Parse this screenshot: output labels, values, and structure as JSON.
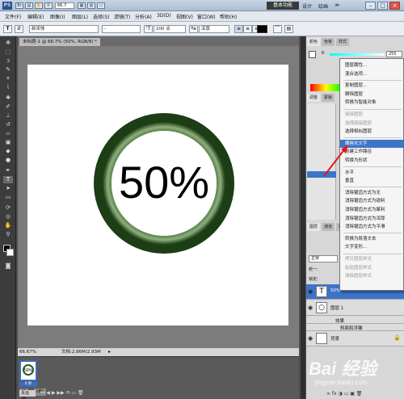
{
  "titlebar": {
    "logo": "PS",
    "zoom": "66.7",
    "workspace_active": "基本功能",
    "workspace_links": [
      "设计",
      "绘画",
      "≫"
    ],
    "window_buttons": [
      "–",
      "□",
      "×"
    ]
  },
  "menubar": {
    "items": [
      "文件(F)",
      "编辑(E)",
      "图像(I)",
      "图层(L)",
      "选择(S)",
      "滤镜(T)",
      "分析(A)",
      "3D(D)",
      "视图(V)",
      "窗口(W)",
      "帮助(H)"
    ]
  },
  "options": {
    "tool_glyph": "T",
    "font_family": "新宋体",
    "font_style": "-",
    "font_size": "200 点",
    "antialias": "浑厚",
    "align": [
      "≡",
      "≡",
      "≡"
    ]
  },
  "document": {
    "tab_title": "未标题-1 @ 66.7% (50%, RGB/8) *",
    "canvas_text": "50%",
    "ring_color": "#2b5a1e",
    "status_zoom": "66.67%",
    "status_doc": "文档:2.86M/2.93M",
    "thumb_text": "50%",
    "thumb_label": "0 秒",
    "filmstrip_tabs": [
      "动画",
      "(帧)"
    ],
    "filmstrip_loop": "永远"
  },
  "panels": {
    "color_tabs": [
      "颜色",
      "色板",
      "样式"
    ],
    "color_value": "255",
    "adjust_tabs": [
      "调整",
      "蒙版"
    ],
    "layer_tabs": [
      "图层",
      "通道",
      "路径"
    ],
    "blend_mode": "正常",
    "unify_label": "统一:",
    "lock_label": "锁定:",
    "layers": [
      {
        "name": "50%",
        "thumb": "T"
      },
      {
        "name": "图层 1",
        "thumb": "○"
      },
      {
        "name": "效果",
        "thumb": ""
      },
      {
        "name": "斜面和浮雕",
        "thumb": ""
      },
      {
        "name": "背景",
        "thumb": ""
      }
    ]
  },
  "context_menu": {
    "items": [
      {
        "label": "图层属性...",
        "state": "normal"
      },
      {
        "label": "混合选项...",
        "state": "normal"
      },
      {
        "label": "复制图层...",
        "state": "normal"
      },
      {
        "label": "删除图层",
        "state": "normal"
      },
      {
        "label": "转换为智能对象",
        "state": "normal"
      },
      {
        "label": "链接图层",
        "state": "disabled"
      },
      {
        "label": "选择链接图层",
        "state": "disabled"
      },
      {
        "label": "选择相似图层",
        "state": "normal"
      },
      {
        "label": "栅格化文字",
        "state": "highlighted"
      },
      {
        "label": "创建工作路径",
        "state": "normal"
      },
      {
        "label": "转换为形状",
        "state": "normal"
      },
      {
        "label": "水平",
        "state": "normal"
      },
      {
        "label": "垂直",
        "state": "normal"
      },
      {
        "label": "消除锯齿方式为无",
        "state": "normal"
      },
      {
        "label": "消除锯齿方式为锐利",
        "state": "normal"
      },
      {
        "label": "消除锯齿方式为犀利",
        "state": "normal"
      },
      {
        "label": "消除锯齿方式为浑厚",
        "state": "normal"
      },
      {
        "label": "消除锯齿方式为平滑",
        "state": "normal"
      },
      {
        "label": "转换为段落文本",
        "state": "normal"
      },
      {
        "label": "文字变形...",
        "state": "normal"
      },
      {
        "label": "拷贝图层样式",
        "state": "disabled"
      },
      {
        "label": "粘贴图层样式",
        "state": "disabled"
      },
      {
        "label": "清除图层样式",
        "state": "disabled"
      }
    ]
  },
  "watermark": "Bai 经验",
  "watermark_sub": "jingyan.baidu.com"
}
